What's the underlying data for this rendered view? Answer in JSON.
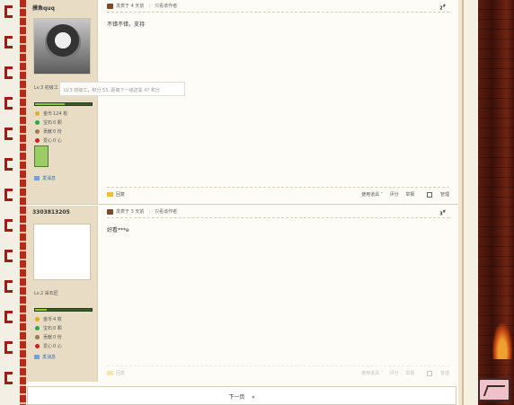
{
  "posts": [
    {
      "username": "摸鱼quq",
      "overlay_text": "LV.3 初级工，积分 53, 距离下一级还需 47 积分",
      "level_label": "Lv.3 初级工",
      "progress": 0.53,
      "stats": [
        {
          "label": "金币",
          "value": "124 枚",
          "color": "#e0b020"
        },
        {
          "label": "宝石",
          "value": "0 颗",
          "color": "#2aa84a"
        },
        {
          "label": "贡献",
          "value": "0 份",
          "color": "#a07850"
        },
        {
          "label": "爱心",
          "value": "0 心",
          "color": "#d02020"
        }
      ],
      "pm_label": "发消息",
      "meta": {
        "posted": "发表于 4 天前",
        "only_author": "只看该作者"
      },
      "floor": "2",
      "content": "不错不错，支持",
      "footer": {
        "reply": "回复",
        "use_item": "使用道具 ˅",
        "rate": "评分",
        "report": "举报",
        "manage": "管理"
      }
    },
    {
      "username": "3303813205",
      "level_label": "Lv.2 采石匠",
      "progress": 0.2,
      "stats": [
        {
          "label": "金币",
          "value": "4 枚",
          "color": "#e0b020"
        },
        {
          "label": "宝石",
          "value": "0 颗",
          "color": "#2aa84a"
        },
        {
          "label": "贡献",
          "value": "0 份",
          "color": "#a07850"
        },
        {
          "label": "爱心",
          "value": "0 心",
          "color": "#d02020"
        }
      ],
      "pm_label": "发消息",
      "meta": {
        "posted": "发表于 3 天前",
        "only_author": "只看该作者"
      },
      "floor": "3",
      "content": "好看***e",
      "footer": {
        "reply": "回复",
        "use_item": "使用道具 ˅",
        "rate": "评分",
        "report": "举报",
        "manage": "管理"
      }
    }
  ],
  "pager": {
    "next": "下一页",
    "arrow": "»"
  }
}
